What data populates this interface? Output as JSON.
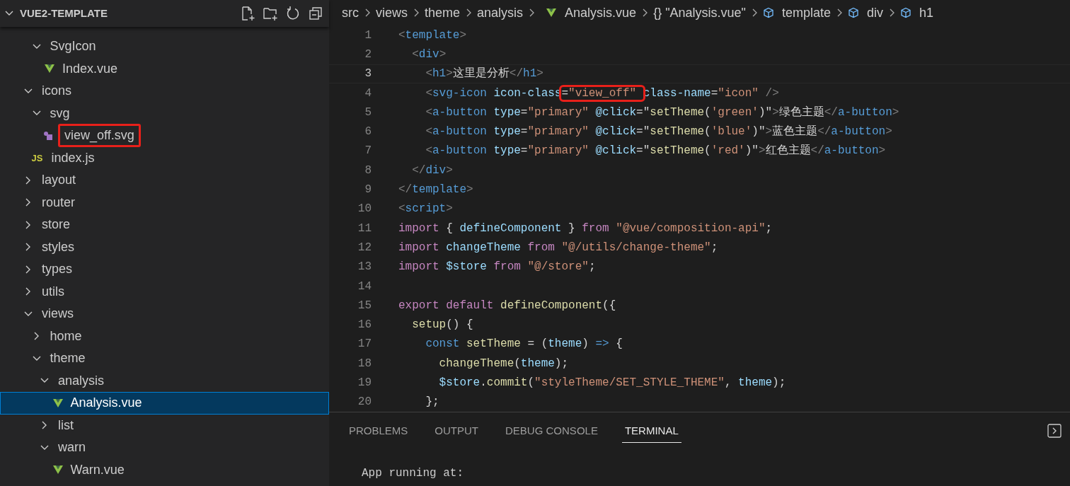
{
  "explorer": {
    "title": "VUE2-TEMPLATE",
    "expanded": true,
    "continued_items": [
      {
        "label": "SvgIcon",
        "kind": "folder",
        "expanded": true,
        "selected": false,
        "annotated": false,
        "children": [
          {
            "label": "Index.vue",
            "kind": "vue",
            "selected": false,
            "annotated": false
          }
        ]
      }
    ],
    "items": [
      {
        "label": "icons",
        "kind": "folder",
        "expanded": true,
        "selected": false,
        "annotated": false,
        "children": [
          {
            "label": "svg",
            "kind": "folder",
            "expanded": true,
            "selected": false,
            "annotated": false,
            "children": [
              {
                "label": "view_off.svg",
                "kind": "svg",
                "selected": false,
                "annotated": true
              }
            ]
          },
          {
            "label": "index.js",
            "kind": "js",
            "icon_text": "JS",
            "selected": false,
            "annotated": false
          }
        ]
      },
      {
        "label": "layout",
        "kind": "folder",
        "expanded": false,
        "selected": false,
        "annotated": false
      },
      {
        "label": "router",
        "kind": "folder",
        "expanded": false,
        "selected": false,
        "annotated": false
      },
      {
        "label": "store",
        "kind": "folder",
        "expanded": false,
        "selected": false,
        "annotated": false
      },
      {
        "label": "styles",
        "kind": "folder",
        "expanded": false,
        "selected": false,
        "annotated": false
      },
      {
        "label": "types",
        "kind": "folder",
        "expanded": false,
        "selected": false,
        "annotated": false
      },
      {
        "label": "utils",
        "kind": "folder",
        "expanded": false,
        "selected": false,
        "annotated": false
      },
      {
        "label": "views",
        "kind": "folder",
        "expanded": true,
        "selected": false,
        "annotated": false,
        "children": [
          {
            "label": "home",
            "kind": "folder",
            "expanded": false,
            "selected": false,
            "annotated": false
          },
          {
            "label": "theme",
            "kind": "folder",
            "expanded": true,
            "selected": false,
            "annotated": false,
            "children": [
              {
                "label": "analysis",
                "kind": "folder",
                "expanded": true,
                "selected": false,
                "annotated": false,
                "children": [
                  {
                    "label": "Analysis.vue",
                    "kind": "vue",
                    "selected": true,
                    "annotated": false
                  }
                ]
              },
              {
                "label": "list",
                "kind": "folder",
                "expanded": false,
                "selected": false,
                "annotated": false
              },
              {
                "label": "warn",
                "kind": "folder",
                "expanded": true,
                "selected": false,
                "annotated": false,
                "children": [
                  {
                    "label": "Warn.vue",
                    "kind": "vue",
                    "selected": false,
                    "annotated": false
                  }
                ]
              }
            ]
          }
        ]
      }
    ]
  },
  "breadcrumbs": [
    {
      "label": "src",
      "kind": "folder"
    },
    {
      "label": "views",
      "kind": "folder"
    },
    {
      "label": "theme",
      "kind": "folder"
    },
    {
      "label": "analysis",
      "kind": "folder"
    },
    {
      "label": "Analysis.vue",
      "kind": "vue"
    },
    {
      "label": "\"Analysis.vue\"",
      "kind": "symbol",
      "symbol": "{}"
    },
    {
      "label": "template",
      "kind": "element"
    },
    {
      "label": "div",
      "kind": "element"
    },
    {
      "label": "h1",
      "kind": "element"
    }
  ],
  "editor": {
    "lines": [
      {
        "number": "1",
        "current": false,
        "tokens": [
          {
            "kind": "punct",
            "text": "<"
          },
          {
            "kind": "tag",
            "text": "template"
          },
          {
            "kind": "punct",
            "text": ">"
          }
        ]
      },
      {
        "number": "2",
        "current": false,
        "tokens": [
          {
            "kind": "punct",
            "text": "  <"
          },
          {
            "kind": "tag",
            "text": "div"
          },
          {
            "kind": "punct",
            "text": ">"
          }
        ]
      },
      {
        "number": "3",
        "current": true,
        "tokens": [
          {
            "kind": "punct",
            "text": "    <"
          },
          {
            "kind": "tag",
            "text": "h1"
          },
          {
            "kind": "punct",
            "text": ">"
          },
          {
            "kind": "text",
            "text": "这里是分析"
          },
          {
            "kind": "punct",
            "text": "</"
          },
          {
            "kind": "tag",
            "text": "h1"
          },
          {
            "kind": "punct",
            "text": ">"
          }
        ]
      },
      {
        "number": "4",
        "current": false,
        "tokens": [
          {
            "kind": "punct",
            "text": "    <"
          },
          {
            "kind": "tag",
            "text": "svg-icon "
          },
          {
            "kind": "attr",
            "text": "icon-class"
          },
          {
            "kind": "annotation",
            "parts": [
              {
                "kind": "text",
                "text": "="
              },
              {
                "kind": "string",
                "text": "\"view_off\" "
              }
            ]
          },
          {
            "kind": "attr",
            "text": "class-name"
          },
          {
            "kind": "text",
            "text": "="
          },
          {
            "kind": "string",
            "text": "\"icon\" "
          },
          {
            "kind": "punct",
            "text": "/>"
          }
        ]
      },
      {
        "number": "5",
        "current": false,
        "tokens": [
          {
            "kind": "punct",
            "text": "    <"
          },
          {
            "kind": "tag",
            "text": "a-button "
          },
          {
            "kind": "attr",
            "text": "type"
          },
          {
            "kind": "text",
            "text": "="
          },
          {
            "kind": "string",
            "text": "\"primary\" "
          },
          {
            "kind": "attr",
            "text": "@click"
          },
          {
            "kind": "text",
            "text": "=\""
          },
          {
            "kind": "func",
            "text": "setTheme"
          },
          {
            "kind": "text",
            "text": "("
          },
          {
            "kind": "string",
            "text": "'green'"
          },
          {
            "kind": "text",
            "text": ")\""
          },
          {
            "kind": "punct",
            "text": ">"
          },
          {
            "kind": "text",
            "text": "绿色主题"
          },
          {
            "kind": "punct",
            "text": "</"
          },
          {
            "kind": "tag",
            "text": "a-button"
          },
          {
            "kind": "punct",
            "text": ">"
          }
        ]
      },
      {
        "number": "6",
        "current": false,
        "tokens": [
          {
            "kind": "punct",
            "text": "    <"
          },
          {
            "kind": "tag",
            "text": "a-button "
          },
          {
            "kind": "attr",
            "text": "type"
          },
          {
            "kind": "text",
            "text": "="
          },
          {
            "kind": "string",
            "text": "\"primary\" "
          },
          {
            "kind": "attr",
            "text": "@click"
          },
          {
            "kind": "text",
            "text": "=\""
          },
          {
            "kind": "func",
            "text": "setTheme"
          },
          {
            "kind": "text",
            "text": "("
          },
          {
            "kind": "string",
            "text": "'blue'"
          },
          {
            "kind": "text",
            "text": ")\""
          },
          {
            "kind": "punct",
            "text": ">"
          },
          {
            "kind": "text",
            "text": "蓝色主题"
          },
          {
            "kind": "punct",
            "text": "</"
          },
          {
            "kind": "tag",
            "text": "a-button"
          },
          {
            "kind": "punct",
            "text": ">"
          }
        ]
      },
      {
        "number": "7",
        "current": false,
        "tokens": [
          {
            "kind": "punct",
            "text": "    <"
          },
          {
            "kind": "tag",
            "text": "a-button "
          },
          {
            "kind": "attr",
            "text": "type"
          },
          {
            "kind": "text",
            "text": "="
          },
          {
            "kind": "string",
            "text": "\"primary\" "
          },
          {
            "kind": "attr",
            "text": "@click"
          },
          {
            "kind": "text",
            "text": "=\""
          },
          {
            "kind": "func",
            "text": "setTheme"
          },
          {
            "kind": "text",
            "text": "("
          },
          {
            "kind": "string",
            "text": "'red'"
          },
          {
            "kind": "text",
            "text": ")\""
          },
          {
            "kind": "punct",
            "text": ">"
          },
          {
            "kind": "text",
            "text": "红色主题"
          },
          {
            "kind": "punct",
            "text": "</"
          },
          {
            "kind": "tag",
            "text": "a-button"
          },
          {
            "kind": "punct",
            "text": ">"
          }
        ]
      },
      {
        "number": "8",
        "current": false,
        "tokens": [
          {
            "kind": "punct",
            "text": "  </"
          },
          {
            "kind": "tag",
            "text": "div"
          },
          {
            "kind": "punct",
            "text": ">"
          }
        ]
      },
      {
        "number": "9",
        "current": false,
        "tokens": [
          {
            "kind": "punct",
            "text": "</"
          },
          {
            "kind": "tag",
            "text": "template"
          },
          {
            "kind": "punct",
            "text": ">"
          }
        ]
      },
      {
        "number": "10",
        "current": false,
        "tokens": [
          {
            "kind": "punct",
            "text": "<"
          },
          {
            "kind": "tag",
            "text": "script"
          },
          {
            "kind": "punct",
            "text": ">"
          }
        ]
      },
      {
        "number": "11",
        "current": false,
        "tokens": [
          {
            "kind": "keyword",
            "text": "import"
          },
          {
            "kind": "text",
            "text": " { "
          },
          {
            "kind": "var",
            "text": "defineComponent"
          },
          {
            "kind": "text",
            "text": " } "
          },
          {
            "kind": "keyword",
            "text": "from "
          },
          {
            "kind": "string",
            "text": "\"@vue/composition-api\""
          },
          {
            "kind": "text",
            "text": ";"
          }
        ]
      },
      {
        "number": "12",
        "current": false,
        "tokens": [
          {
            "kind": "keyword",
            "text": "import "
          },
          {
            "kind": "var",
            "text": "changeTheme "
          },
          {
            "kind": "keyword",
            "text": "from "
          },
          {
            "kind": "string",
            "text": "\"@/utils/change-theme\""
          },
          {
            "kind": "text",
            "text": ";"
          }
        ]
      },
      {
        "number": "13",
        "current": false,
        "tokens": [
          {
            "kind": "keyword",
            "text": "import "
          },
          {
            "kind": "var",
            "text": "$store "
          },
          {
            "kind": "keyword",
            "text": "from "
          },
          {
            "kind": "string",
            "text": "\"@/store\""
          },
          {
            "kind": "text",
            "text": ";"
          }
        ]
      },
      {
        "number": "14",
        "current": false
      },
      {
        "number": "15",
        "current": false,
        "tokens": [
          {
            "kind": "keyword",
            "text": "export default "
          },
          {
            "kind": "func",
            "text": "defineComponent"
          },
          {
            "kind": "text",
            "text": "({"
          }
        ]
      },
      {
        "number": "16",
        "current": false,
        "tokens": [
          {
            "kind": "func",
            "text": "  setup"
          },
          {
            "kind": "text",
            "text": "() {"
          }
        ]
      },
      {
        "number": "17",
        "current": false,
        "tokens": [
          {
            "kind": "storage",
            "text": "    const "
          },
          {
            "kind": "func",
            "text": "setTheme"
          },
          {
            "kind": "text",
            "text": " = ("
          },
          {
            "kind": "var",
            "text": "theme"
          },
          {
            "kind": "text",
            "text": ") "
          },
          {
            "kind": "storage",
            "text": "=>"
          },
          {
            "kind": "text",
            "text": " {"
          }
        ]
      },
      {
        "number": "18",
        "current": false,
        "tokens": [
          {
            "kind": "func",
            "text": "      changeTheme"
          },
          {
            "kind": "text",
            "text": "("
          },
          {
            "kind": "var",
            "text": "theme"
          },
          {
            "kind": "text",
            "text": ");"
          }
        ]
      },
      {
        "number": "19",
        "current": false,
        "tokens": [
          {
            "kind": "var",
            "text": "      $store"
          },
          {
            "kind": "text",
            "text": "."
          },
          {
            "kind": "func",
            "text": "commit"
          },
          {
            "kind": "text",
            "text": "("
          },
          {
            "kind": "string",
            "text": "\"styleTheme/SET_STYLE_THEME\""
          },
          {
            "kind": "text",
            "text": ", "
          },
          {
            "kind": "var",
            "text": "theme"
          },
          {
            "kind": "text",
            "text": ");"
          }
        ]
      },
      {
        "number": "20",
        "current": false,
        "tokens": [
          {
            "kind": "text",
            "text": "    };"
          }
        ]
      }
    ]
  },
  "panel": {
    "tabs": [
      {
        "label": "PROBLEMS",
        "selected": false
      },
      {
        "label": "OUTPUT",
        "selected": false
      },
      {
        "label": "DEBUG CONSOLE",
        "selected": false
      },
      {
        "label": "TERMINAL",
        "selected": true
      }
    ],
    "terminal_lines": [
      "App running at:"
    ]
  }
}
